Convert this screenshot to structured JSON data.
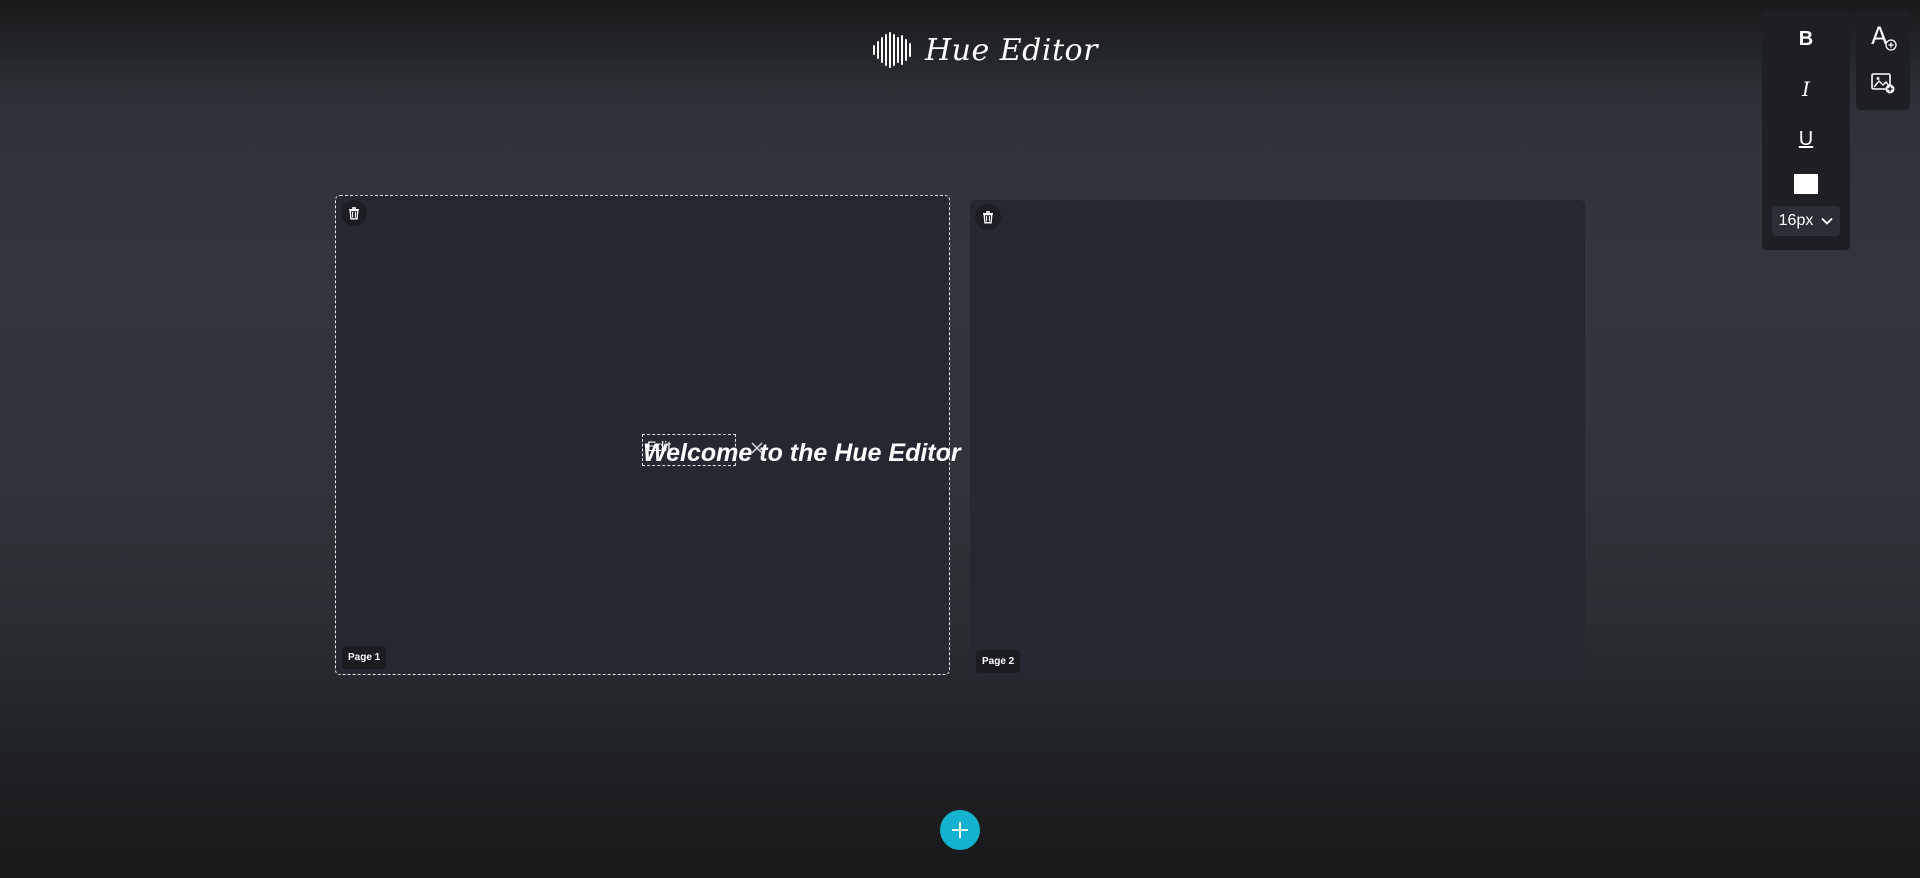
{
  "app": {
    "title": "Hue Editor"
  },
  "pages": [
    {
      "label": "Page 1",
      "selected": true,
      "text_element": "Welcome to the Hue Editor",
      "edit_chip": "Edit"
    },
    {
      "label": "Page 2",
      "selected": false
    }
  ],
  "toolbar": {
    "bold": "B",
    "italic": "I",
    "underline": "U",
    "color": "#ffffff",
    "font_size": "16px"
  },
  "side_panel": {
    "add_text_icon": "add-text-icon",
    "add_image_icon": "add-image-icon"
  },
  "colors": {
    "accent": "#13b3cf",
    "page_bg": "#252830",
    "panel_bg": "#1d1f24"
  }
}
